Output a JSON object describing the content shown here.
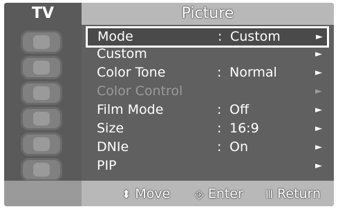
{
  "header": {
    "tv_label": "TV",
    "menu_title": "Picture"
  },
  "sidebar": {
    "icons": [
      "picture-mode-icon",
      "sound-icon",
      "channel-icon",
      "setup-icon",
      "input-icon",
      "app-icon"
    ]
  },
  "menu": {
    "items": [
      {
        "label": "Mode",
        "colon": ":",
        "value": "Custom",
        "arrow": "►",
        "selected": true,
        "disabled": false
      },
      {
        "label": "Custom",
        "colon": "",
        "value": "",
        "arrow": "►",
        "selected": false,
        "disabled": false
      },
      {
        "label": "Color Tone",
        "colon": ":",
        "value": "Normal",
        "arrow": "►",
        "selected": false,
        "disabled": false
      },
      {
        "label": "Color Control",
        "colon": "",
        "value": "",
        "arrow": "►",
        "selected": false,
        "disabled": true
      },
      {
        "label": "Film Mode",
        "colon": ":",
        "value": "Off",
        "arrow": "►",
        "selected": false,
        "disabled": false
      },
      {
        "label": "Size",
        "colon": ":",
        "value": "16:9",
        "arrow": "►",
        "selected": false,
        "disabled": false
      },
      {
        "label": "DNIe",
        "colon": ":",
        "value": "On",
        "arrow": "►",
        "selected": false,
        "disabled": false
      },
      {
        "label": "PIP",
        "colon": "",
        "value": "",
        "arrow": "►",
        "selected": false,
        "disabled": false
      }
    ]
  },
  "footer": {
    "move_icon": "⬍",
    "move_label": "Move",
    "enter_icon": "⎆",
    "enter_label": "Enter",
    "return_icon": "Ⅲ",
    "return_label": "Return"
  }
}
